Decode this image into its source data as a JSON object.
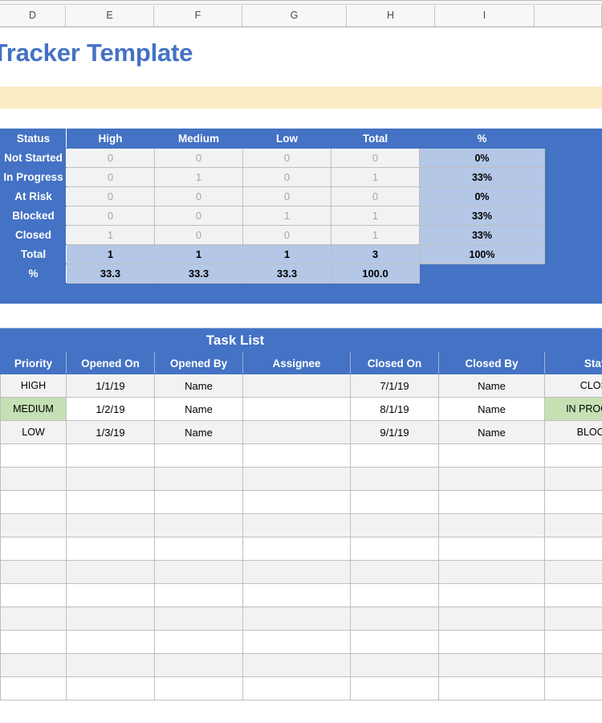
{
  "window": {
    "app": "spreadsheet",
    "column_headers": [
      "D",
      "E",
      "F",
      "G",
      "H",
      "I"
    ]
  },
  "document": {
    "title": "Issue Tracker Template",
    "title_color": "#4472C4",
    "note_band_color": "#FCECC4"
  },
  "summary": {
    "accent_color": "#4472C4",
    "pct_fill_color": "#B4C7E7",
    "headers": [
      "Status",
      "High",
      "Medium",
      "Low",
      "Total",
      "%"
    ],
    "rows": [
      {
        "status": "Not Started",
        "high": "0",
        "medium": "0",
        "low": "0",
        "total": "0",
        "pct": "0%"
      },
      {
        "status": "In Progress",
        "high": "0",
        "medium": "1",
        "low": "0",
        "total": "1",
        "pct": "33%"
      },
      {
        "status": "At Risk",
        "high": "0",
        "medium": "0",
        "low": "0",
        "total": "0",
        "pct": "0%"
      },
      {
        "status": "Blocked",
        "high": "0",
        "medium": "0",
        "low": "1",
        "total": "1",
        "pct": "33%"
      },
      {
        "status": "Closed",
        "high": "1",
        "medium": "0",
        "low": "0",
        "total": "1",
        "pct": "33%"
      }
    ],
    "total_row": {
      "status": "Total",
      "high": "1",
      "medium": "1",
      "low": "1",
      "total": "3",
      "pct": "100%"
    },
    "pct_row": {
      "status": "%",
      "high": "33.3",
      "medium": "33.3",
      "low": "33.3",
      "total": "100.0",
      "pct": ""
    }
  },
  "task_list": {
    "banner": "Task List",
    "headers": [
      "Priority",
      "Opened On",
      "Opened By",
      "Assignee",
      "Closed On",
      "Closed By",
      "Status"
    ],
    "rows": [
      {
        "priority": "HIGH",
        "priority_level": "high",
        "opened_on": "1/1/19",
        "opened_by": "Name",
        "assignee": "",
        "closed_on": "7/1/19",
        "closed_by": "Name",
        "status": "CLOSED",
        "status_key": "closed"
      },
      {
        "priority": "MEDIUM",
        "priority_level": "medium",
        "opened_on": "1/2/19",
        "opened_by": "Name",
        "assignee": "",
        "closed_on": "8/1/19",
        "closed_by": "Name",
        "status": "IN PROGRESS",
        "status_key": "inprogress"
      },
      {
        "priority": "LOW",
        "priority_level": "low",
        "opened_on": "1/3/19",
        "opened_by": "Name",
        "assignee": "",
        "closed_on": "9/1/19",
        "closed_by": "Name",
        "status": "BLOCKED",
        "status_key": "blocked"
      }
    ],
    "empty_row_count": 11,
    "status_colors": {
      "closed": "#00B050",
      "inprogress": "#C6E0B4",
      "blocked": "#FF0000"
    },
    "priority_colors": {
      "high": "#A9D18E",
      "medium": "#C5E0B4",
      "low": "#E2EFDA"
    }
  }
}
